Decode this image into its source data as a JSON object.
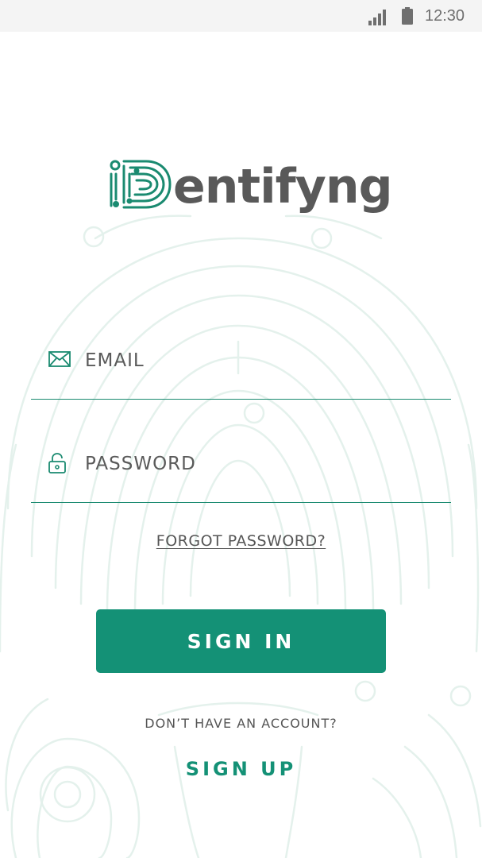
{
  "status_bar": {
    "time": "12:30",
    "signal_icon": "signal-icon",
    "battery_icon": "battery-icon"
  },
  "logo": {
    "mark_text": "iD",
    "text": "entifyng"
  },
  "form": {
    "email": {
      "placeholder": "EMAIL",
      "value": "",
      "icon": "envelope-icon"
    },
    "password": {
      "placeholder": "PASSWORD",
      "value": "",
      "icon": "unlock-icon"
    },
    "forgot_label": "FORGOT PASSWORD?",
    "signin_label": "SIGN IN"
  },
  "footer": {
    "no_account_text": "DON’T HAVE AN ACCOUNT?",
    "signup_label": "SIGN UP"
  },
  "colors": {
    "accent": "#149176",
    "text_gray": "#595959",
    "status_bar_bg": "#f4f4f4",
    "pattern": "#e6f2ee"
  }
}
